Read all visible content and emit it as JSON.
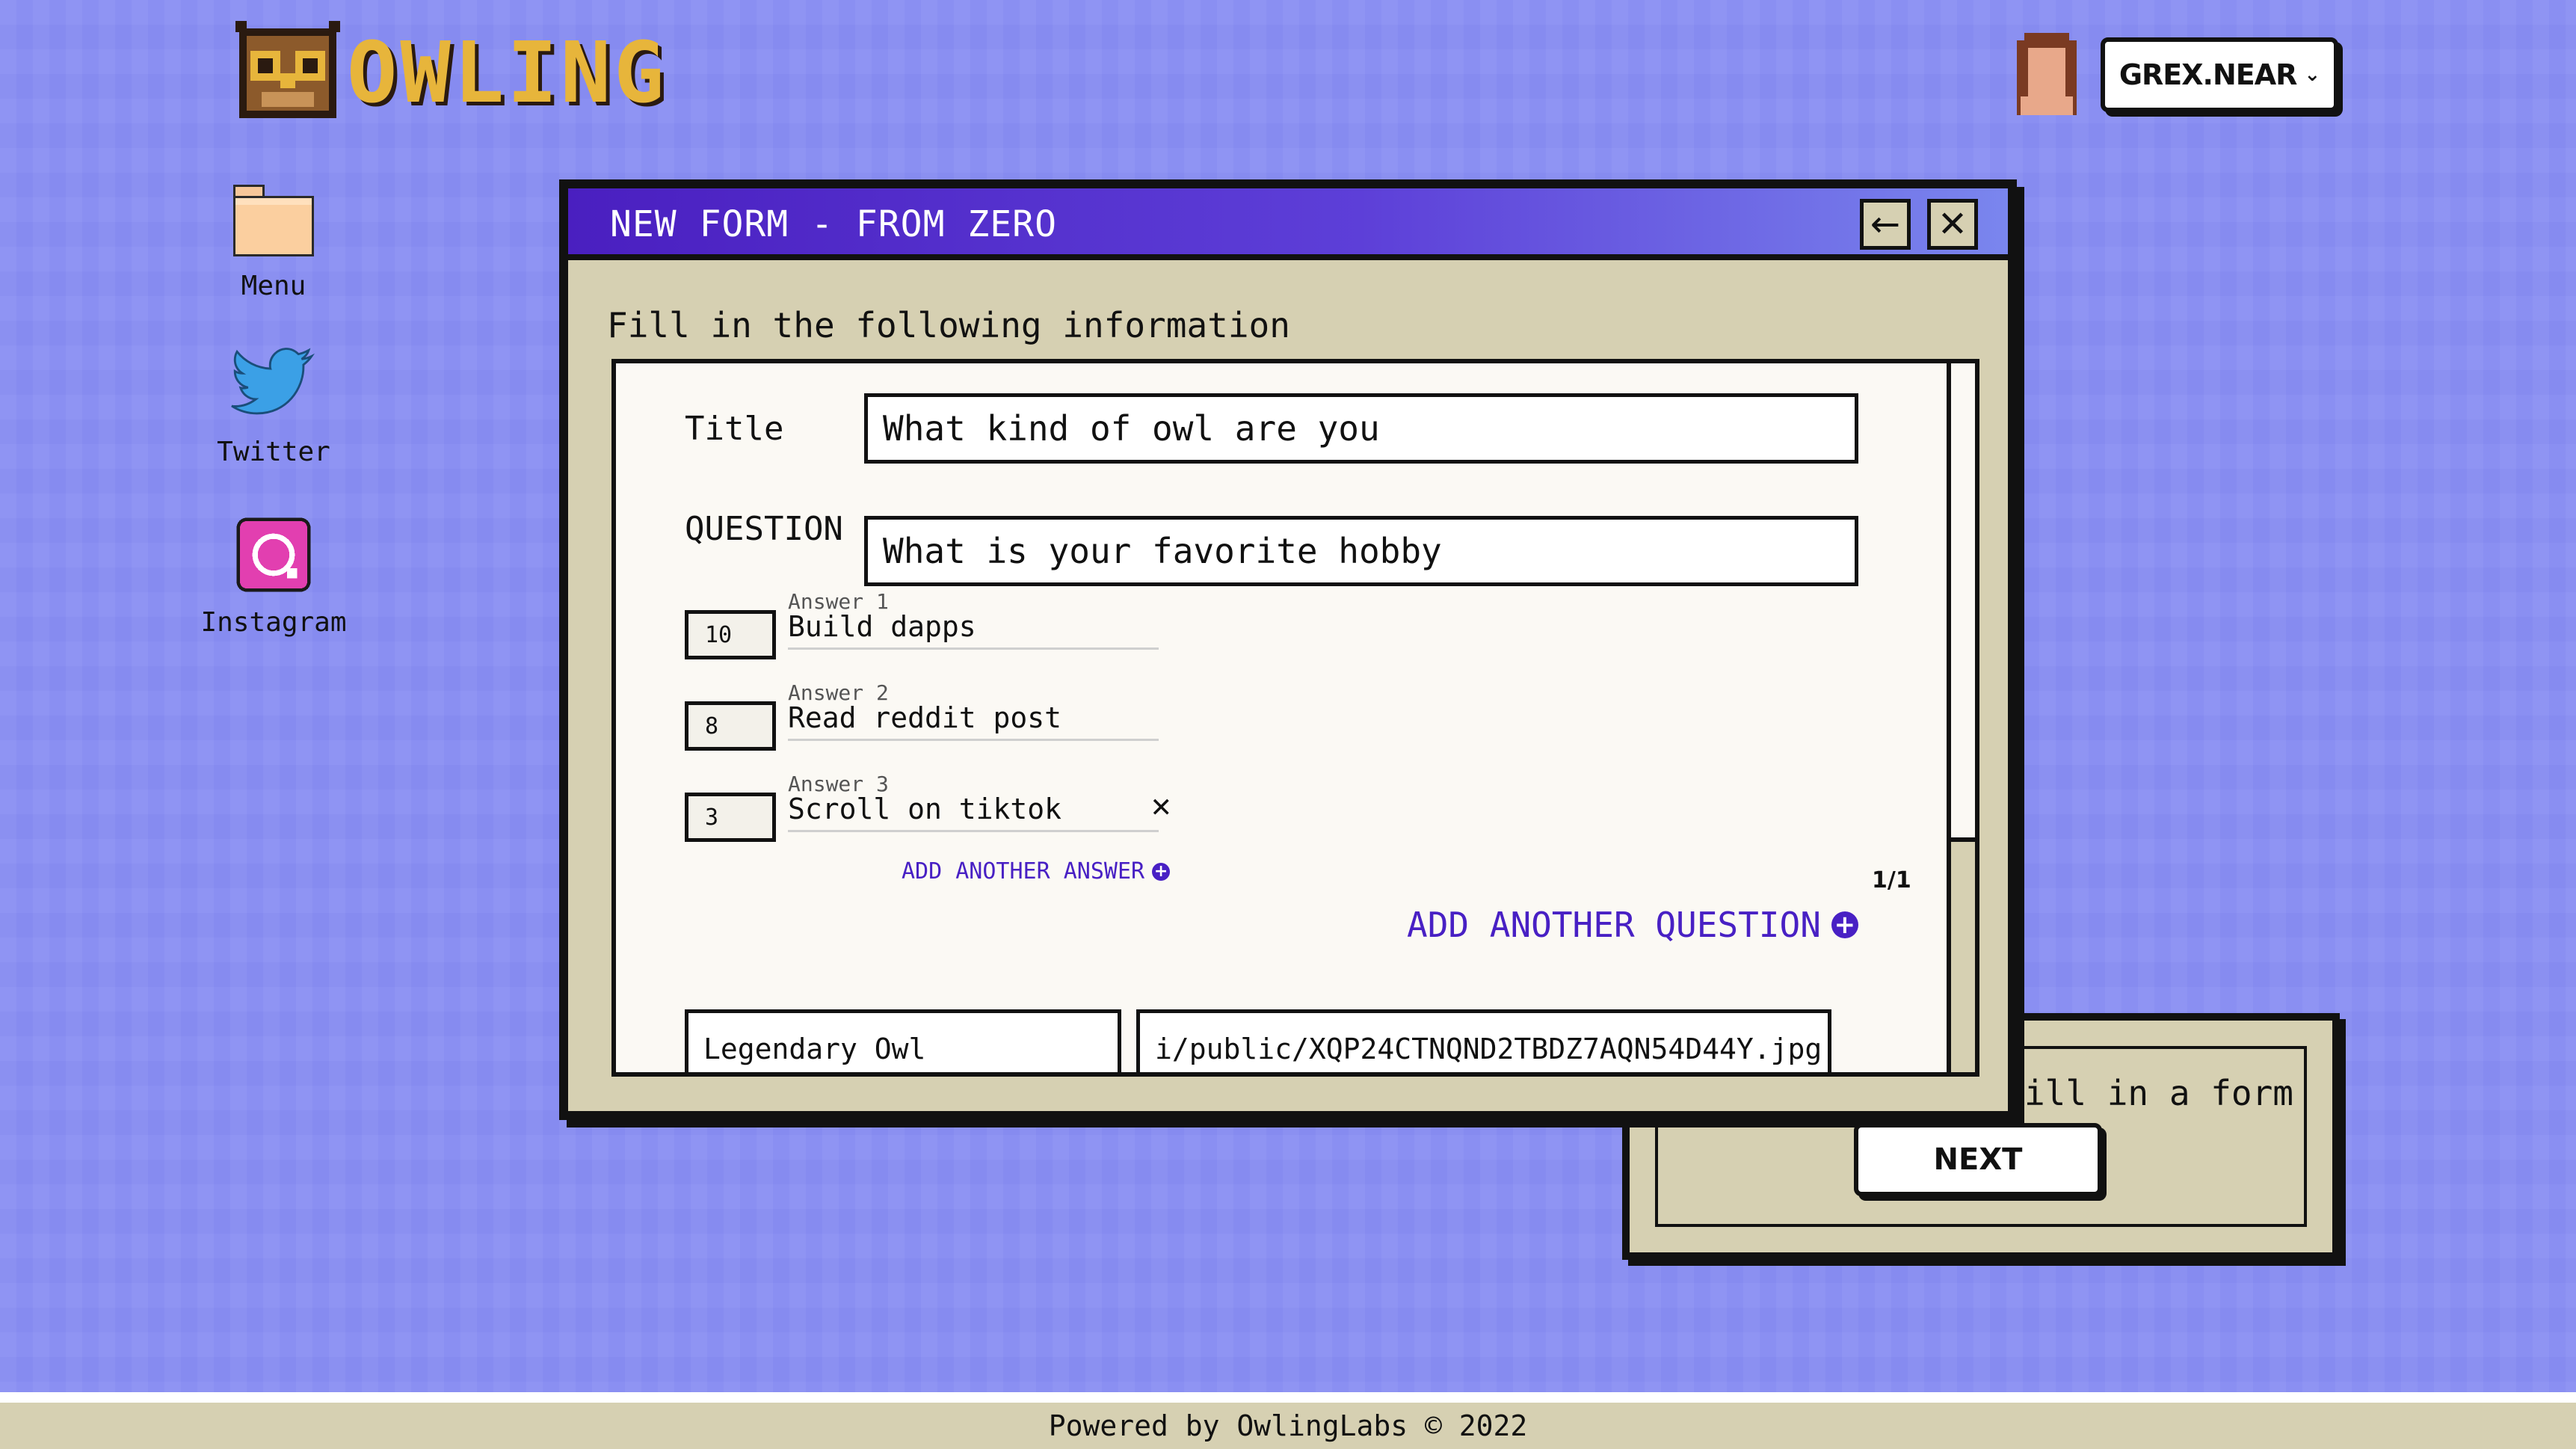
{
  "app": {
    "name": "OWLING"
  },
  "desktop": {
    "icons": [
      {
        "label": "Menu",
        "icon": "folder-icon"
      },
      {
        "label": "Twitter",
        "icon": "twitter-icon"
      },
      {
        "label": "Instagram",
        "icon": "instagram-icon"
      }
    ]
  },
  "header": {
    "account_label": "GREX.NEAR"
  },
  "window": {
    "title": "NEW FORM - FROM ZERO",
    "instruction": "Fill in the following information",
    "title_label": "Title",
    "title_value": "What kind of owl are you",
    "question_label": "QUESTION",
    "question_value": "What is your favorite hobby",
    "answers": [
      {
        "caption": "Answer 1",
        "value": "Build dapps",
        "score": "10"
      },
      {
        "caption": "Answer 2",
        "value": "Read reddit post",
        "score": "8"
      },
      {
        "caption": "Answer 3",
        "value": "Scroll on tiktok",
        "score": "3"
      }
    ],
    "add_answer_label": "ADD ANOTHER ANSWER",
    "pager": "1/1",
    "add_question_label": "ADD ANOTHER QUESTION",
    "result_name": "Legendary Owl",
    "result_image": "i/public/XQP24CTNQND2TBDZ7AQN54D44Y.jpg"
  },
  "back_window": {
    "message": "fill in a form",
    "next_label": "NEXT"
  },
  "footer": {
    "text": "Powered by OwlingLabs © 2022"
  },
  "colors": {
    "background": "#8a8ff2",
    "window_body": "#d6d0b2",
    "title_bar": "#5d3fd8",
    "accent": "#4820c4",
    "logo": "#e7b53b"
  }
}
